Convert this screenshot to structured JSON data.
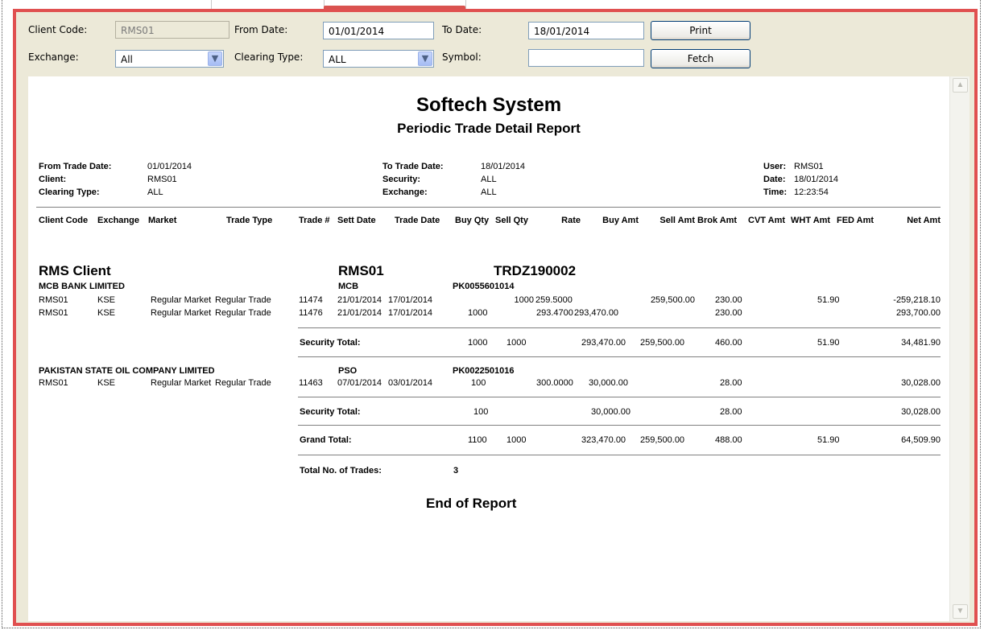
{
  "form": {
    "client_code_label": "Client Code:",
    "client_code_value": "RMS01",
    "from_date_label": "From Date:",
    "from_date_value": "01/01/2014",
    "to_date_label": "To Date:",
    "to_date_value": "18/01/2014",
    "print_label": "Print",
    "exchange_label": "Exchange:",
    "exchange_value": "All",
    "clearing_type_label": "Clearing Type:",
    "clearing_type_value": "ALL",
    "symbol_label": "Symbol:",
    "symbol_value": "",
    "fetch_label": "Fetch"
  },
  "report": {
    "company": "Softech System",
    "title": "Periodic Trade Detail Report",
    "params": {
      "from_trade_date_label": "From Trade Date:",
      "from_trade_date": "01/01/2014",
      "client_label": "Client:",
      "client": "RMS01",
      "clearing_type_label": "Clearing Type:",
      "clearing_type": "ALL",
      "to_trade_date_label": "To Trade Date:",
      "to_trade_date": "18/01/2014",
      "security_label": "Security:",
      "security": "ALL",
      "exchange_label": "Exchange:",
      "exchange": "ALL",
      "user_label": "User:",
      "user": "RMS01",
      "date_label": "Date:",
      "date": "18/01/2014",
      "time_label": "Time:",
      "time": "12:23:54"
    },
    "columns": [
      "Client Code",
      "Exchange",
      "Market",
      "Trade Type",
      "Trade #",
      "Sett Date",
      "Trade Date",
      "Buy Qty",
      "Sell Qty",
      "Rate",
      "Buy Amt",
      "Sell Amt",
      "Brok Amt",
      "CVT Amt",
      "WHT Amt",
      "FED Amt",
      "Net Amt"
    ],
    "group": {
      "name": "RMS Client",
      "code": "RMS01",
      "ref": "TRDZ190002"
    },
    "securities": [
      {
        "name": "MCB BANK LIMITED",
        "symbol": "MCB",
        "isin": "PK0055601014",
        "trades": [
          {
            "client": "RMS01",
            "exchange": "KSE",
            "market": "Regular Market",
            "type": "Regular Trade",
            "trade_no": "11474",
            "sett_date": "21/01/2014",
            "trade_date": "17/01/2014",
            "buy_qty": "",
            "sell_qty": "1000",
            "rate": "259.5000",
            "buy_amt": "",
            "sell_amt": "259,500.00",
            "brok_amt": "230.00",
            "cvt_amt": "",
            "wht_amt": "51.90",
            "fed_amt": "",
            "net_amt": "-259,218.10"
          },
          {
            "client": "RMS01",
            "exchange": "KSE",
            "market": "Regular Market",
            "type": "Regular Trade",
            "trade_no": "11476",
            "sett_date": "21/01/2014",
            "trade_date": "17/01/2014",
            "buy_qty": "1000",
            "sell_qty": "",
            "rate": "293.4700",
            "buy_amt": "293,470.00",
            "sell_amt": "",
            "brok_amt": "230.00",
            "cvt_amt": "",
            "wht_amt": "",
            "fed_amt": "",
            "net_amt": "293,700.00"
          }
        ],
        "total": {
          "label": "Security Total:",
          "buy_qty": "1000",
          "sell_qty": "1000",
          "buy_amt": "293,470.00",
          "sell_amt": "259,500.00",
          "brok_amt": "460.00",
          "wht_amt": "51.90",
          "net_amt": "34,481.90"
        }
      },
      {
        "name": "PAKISTAN STATE OIL COMPANY LIMITED",
        "symbol": "PSO",
        "isin": "PK0022501016",
        "trades": [
          {
            "client": "RMS01",
            "exchange": "KSE",
            "market": "Regular Market",
            "type": "Regular Trade",
            "trade_no": "11463",
            "sett_date": "07/01/2014",
            "trade_date": "03/01/2014",
            "buy_qty": "100",
            "sell_qty": "",
            "rate": "300.0000",
            "buy_amt": "30,000.00",
            "sell_amt": "",
            "brok_amt": "28.00",
            "cvt_amt": "",
            "wht_amt": "",
            "fed_amt": "",
            "net_amt": "30,028.00"
          }
        ],
        "total": {
          "label": "Security Total:",
          "buy_qty": "100",
          "sell_qty": "",
          "buy_amt": "30,000.00",
          "sell_amt": "",
          "brok_amt": "28.00",
          "wht_amt": "",
          "net_amt": "30,028.00"
        }
      }
    ],
    "grand_total": {
      "label": "Grand Total:",
      "buy_qty": "1100",
      "sell_qty": "1000",
      "buy_amt": "323,470.00",
      "sell_amt": "259,500.00",
      "brok_amt": "488.00",
      "wht_amt": "51.90",
      "net_amt": "64,509.90"
    },
    "total_trades_label": "Total No. of Trades:",
    "total_trades": "3",
    "end_label": "End of Report"
  },
  "icons": {
    "dropdown": "chevron-down-icon",
    "scroll_up": "scroll-up-arrow-icon",
    "scroll_down": "scroll-down-arrow-icon"
  }
}
